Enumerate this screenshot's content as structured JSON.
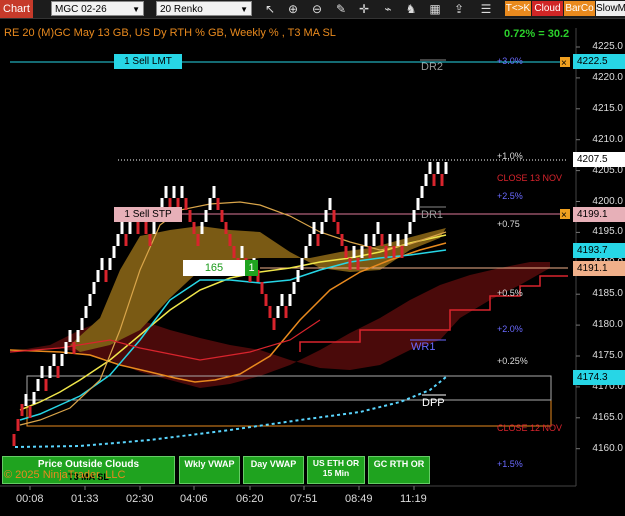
{
  "toolbar": {
    "chart_label": "Chart",
    "instrument": "MGC 02-26",
    "bar_type": "20 Renko",
    "buttons": [
      "T<>K",
      "Cloud",
      "BarCo",
      "SlowM"
    ],
    "icons": [
      "pointer-icon",
      "zoom-in-icon",
      "zoom-out-icon",
      "drawing-tools-icon",
      "crosshair-icon",
      "indicators-icon",
      "strategies-icon",
      "data-box-icon",
      "share-icon"
    ]
  },
  "header": {
    "title": "RE 20  (M)GC May 13 GB, US Dy RTH % GB, Weekly % , T3 MA SL",
    "change": "0.72% = 30.2"
  },
  "y_axis": {
    "ticks": [
      "4225.0",
      "4220.0",
      "4215.0",
      "4210.0",
      "4205.0",
      "4200.0",
      "4195.0",
      "4190.0",
      "4185.0",
      "4180.0",
      "4175.0",
      "4170.0",
      "4165.0",
      "4160.0"
    ],
    "flags": {
      "p4222": "4222.5",
      "p4207": "4207.5",
      "p4199": "4199.1",
      "p4193": "4193.7",
      "p4191": "4191.1",
      "p4174": "4174.3"
    }
  },
  "x_axis": {
    "ticks": [
      "00:08",
      "01:33",
      "02:30",
      "04:06",
      "06:20",
      "07:51",
      "08:49",
      "11:19"
    ]
  },
  "annotations": {
    "sell_lmt": "1 Sell LMT",
    "sell_stp": "1 Sell STP",
    "qty_box": "165",
    "qty_btn": "1",
    "dr2": "DR2",
    "dr1": "DR1",
    "wr1": "WR1",
    "dpp": "DPP",
    "close_13": "CLOSE 13 NOV",
    "close_12": "CLOSE 12 NOV",
    "p3_0": "+3.0%",
    "p1_0": "+1.0%",
    "p2_5": "+2.5%",
    "p0_75": "+0.75",
    "p0_5": "+0.5%",
    "p2_0": "+2.0%",
    "p0_25": "+0.25%",
    "p1_5": "+1.5%",
    "copyright": "© 2025 NinjaTrader, LLC"
  },
  "bottom_buttons": {
    "price_outside": "Price Outside Clouds",
    "t3": "T3 MA SL",
    "wkly_vwap": "Wkly VWAP",
    "day_vwap": "Day VWAP",
    "us_eth": "US ETH OR 15 Min",
    "gc_rth": "GC RTH OR"
  },
  "colors": {
    "background": "#000000",
    "up_brick": "#ffffff",
    "down_brick": "#d9242d",
    "cloud_bull": "#7a5a14",
    "cloud_bear": "#4a0a0a",
    "cyan": "#27d6e6",
    "accent_green": "#1fa31f"
  }
}
